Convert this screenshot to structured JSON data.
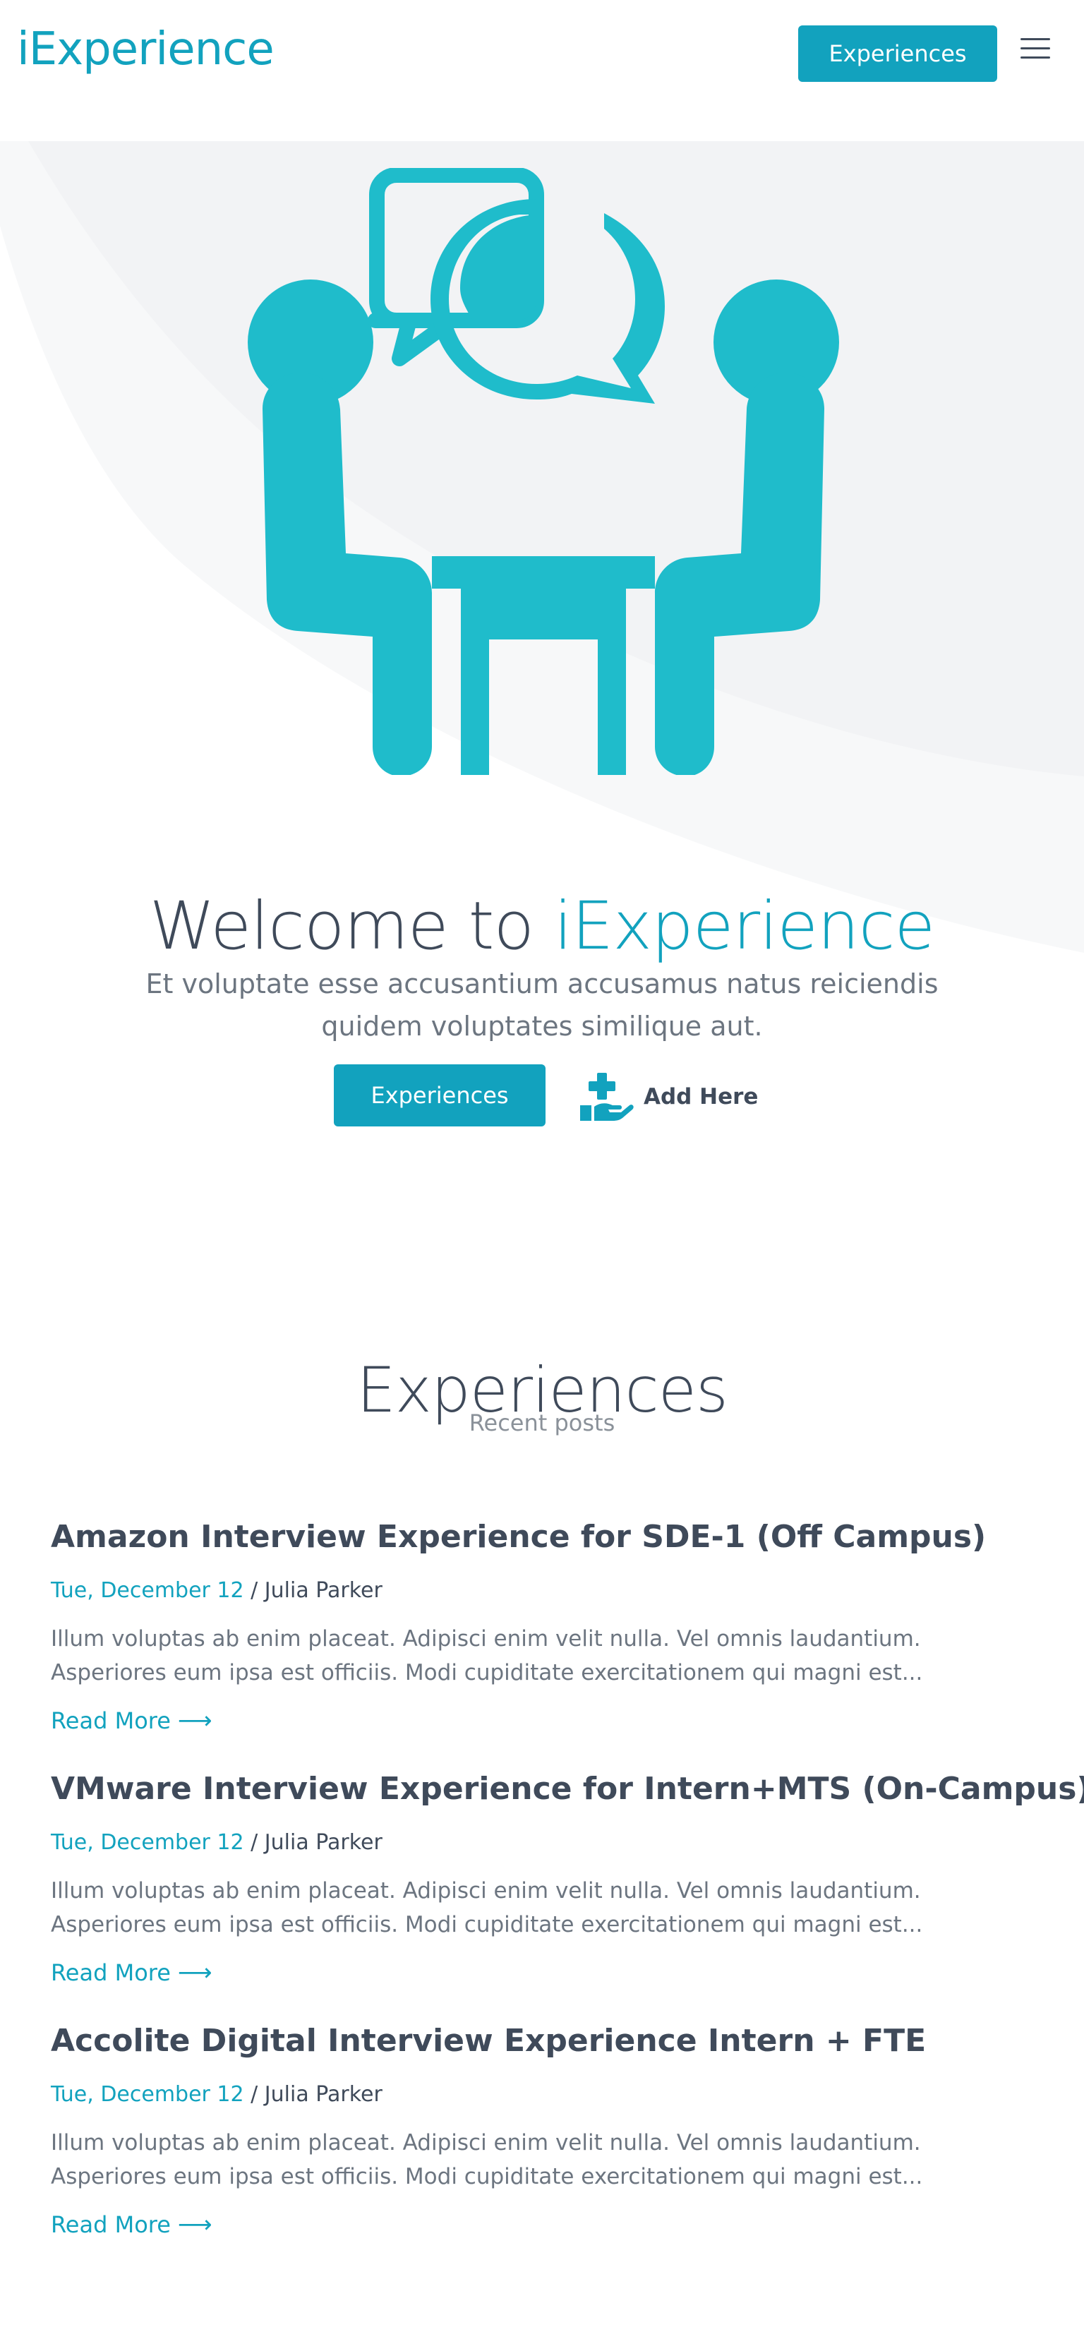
{
  "header": {
    "logo": "iExperience",
    "cta_label": "Experiences",
    "menu_icon": "hamburger-icon"
  },
  "hero": {
    "illustration_icon": "interview-illustration-icon",
    "title_prefix": "Welcome to ",
    "title_accent": "iExperience",
    "subtitle": "Et voluptate esse accusantium accusamus natus reiciendis quidem voluptates similique aut.",
    "primary_label": "Experiences",
    "secondary_label": "Add Here",
    "secondary_icon": "hand-plus-icon"
  },
  "experiences": {
    "title": "Experiences",
    "subtitle": "Recent posts",
    "posts": [
      {
        "title": "Amazon Interview Experience for SDE-1 (Off Campus)",
        "date": "Tue, December 12",
        "author": "Julia Parker",
        "excerpt": "Illum voluptas ab enim placeat. Adipisci enim velit nulla. Vel omnis laudantium. Asperiores eum ipsa est officiis. Modi cupiditate exercitationem qui magni est...",
        "read_more": "Read More"
      },
      {
        "title": "VMware Interview Experience for Intern+MTS (On-Campus)",
        "date": "Tue, December 12",
        "author": "Julia Parker",
        "excerpt": "Illum voluptas ab enim placeat. Adipisci enim velit nulla. Vel omnis laudantium. Asperiores eum ipsa est officiis. Modi cupiditate exercitationem qui magni est...",
        "read_more": "Read More"
      },
      {
        "title": "Accolite Digital Interview Experience Intern + FTE",
        "date": "Tue, December 12",
        "author": "Julia Parker",
        "excerpt": "Illum voluptas ab enim placeat. Adipisci enim velit nulla. Vel omnis laudantium. Asperiores eum ipsa est officiis. Modi cupiditate exercitationem qui magni est...",
        "read_more": "Read More"
      }
    ]
  },
  "colors": {
    "accent": "#12a2be",
    "illustration": "#1fbccb",
    "text": "#3f4a5a",
    "muted": "#6c7580"
  }
}
